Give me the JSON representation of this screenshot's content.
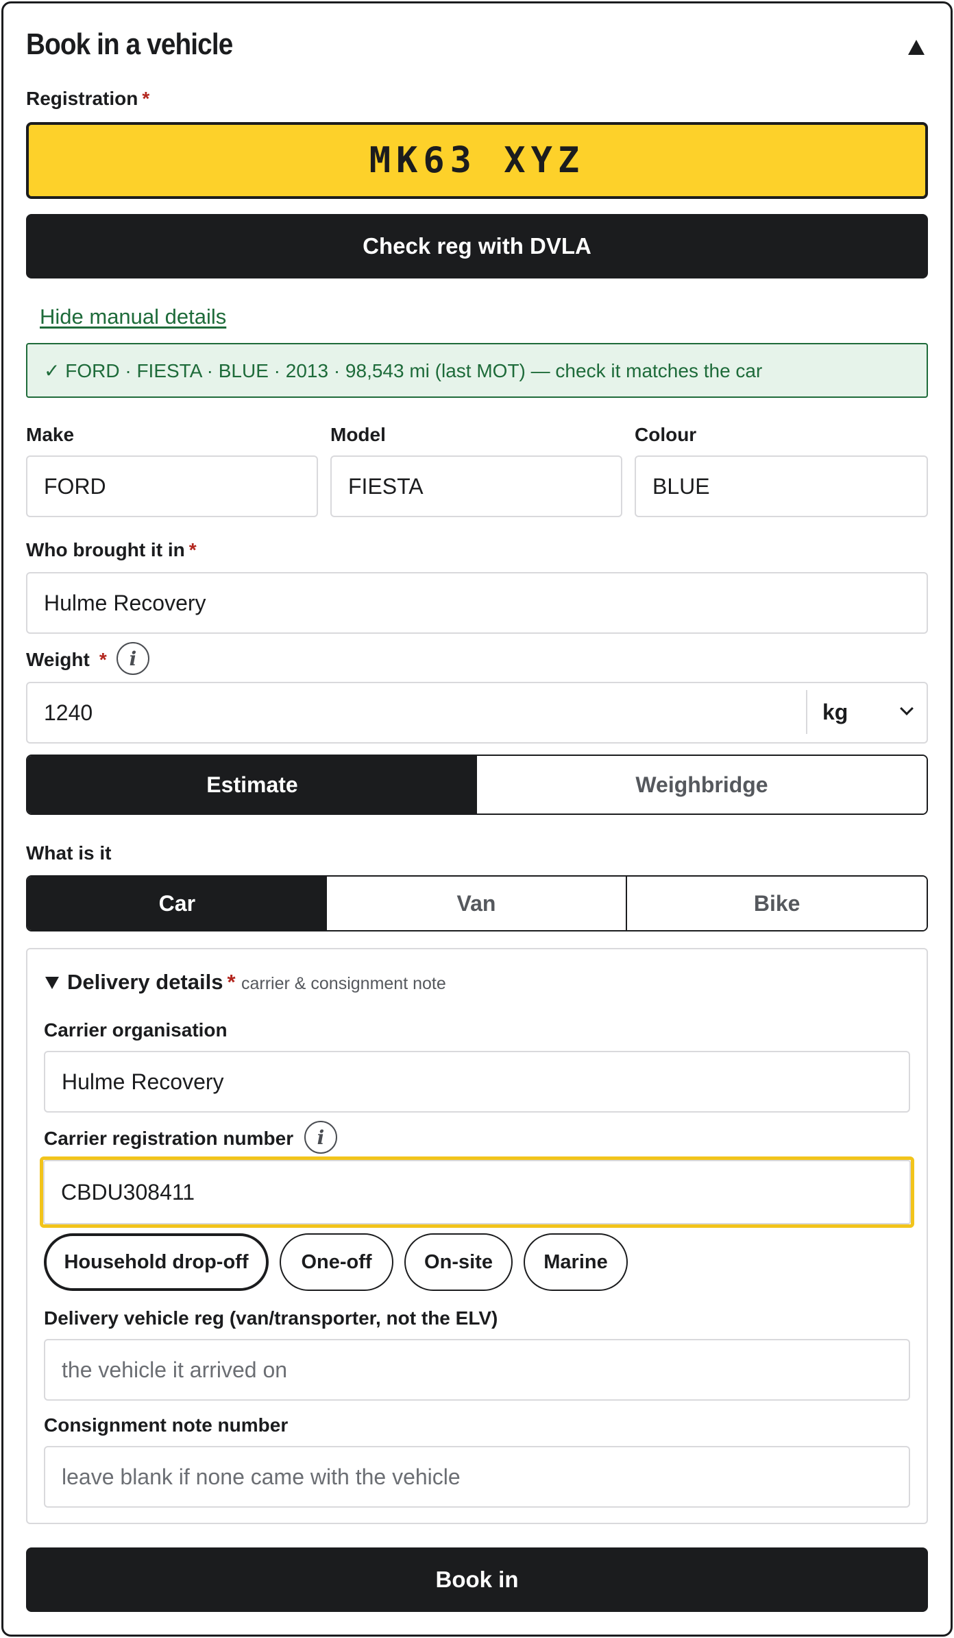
{
  "form": {
    "title": "Book in a vehicle",
    "registration_label": "Registration",
    "required_mark": "*",
    "registration_value": "MK63 XYZ",
    "check_button": "Check reg with DVLA",
    "manual_link": "Hide manual details",
    "dvla_notice": "✓ FORD · FIESTA · BLUE · 2013 · 98,543 mi (last MOT) — check it matches the car",
    "make_label": "Make",
    "make_value": "FORD",
    "model_label": "Model",
    "model_value": "FIESTA",
    "colour_label": "Colour",
    "colour_value": "BLUE",
    "brought_label": "Who brought it in",
    "brought_value": "Hulme Recovery",
    "weight_label": "Weight",
    "weight_value": "1240",
    "weight_unit": "kg",
    "weight_method": [
      "Estimate",
      "Weighbridge"
    ],
    "weight_method_selected": "Estimate",
    "type_label": "What is it",
    "types": [
      "Car",
      "Van",
      "Bike"
    ],
    "type_selected": "Car",
    "submit_button": "Book in"
  },
  "delivery": {
    "summary": "Delivery details",
    "hint": "carrier & consignment note",
    "carrier_org_label": "Carrier organisation",
    "carrier_org_value": "Hulme Recovery",
    "carrier_reg_label": "Carrier registration number",
    "carrier_reg_value": "CBDU308411",
    "carrier_types": [
      "Household drop-off",
      "One-off",
      "On-site",
      "Marine"
    ],
    "carrier_type_selected": "Household drop-off",
    "vehicle_reg_label": "Delivery vehicle reg (van/transporter, not the ELV)",
    "vehicle_reg_placeholder": "the vehicle it arrived on",
    "consignment_label": "Consignment note number",
    "consignment_placeholder": "leave blank if none came with the vehicle"
  },
  "colors": {
    "plate_yellow": "#fdd12a",
    "dark": "#1b1c1e",
    "success_green": "#1e6b3a",
    "required_red": "#b3261e",
    "focus_ring": "#f2c41b"
  },
  "icons": [
    "collapse-up-icon",
    "info-icon",
    "chevron-down-icon",
    "disclosure-triangle-icon"
  ]
}
